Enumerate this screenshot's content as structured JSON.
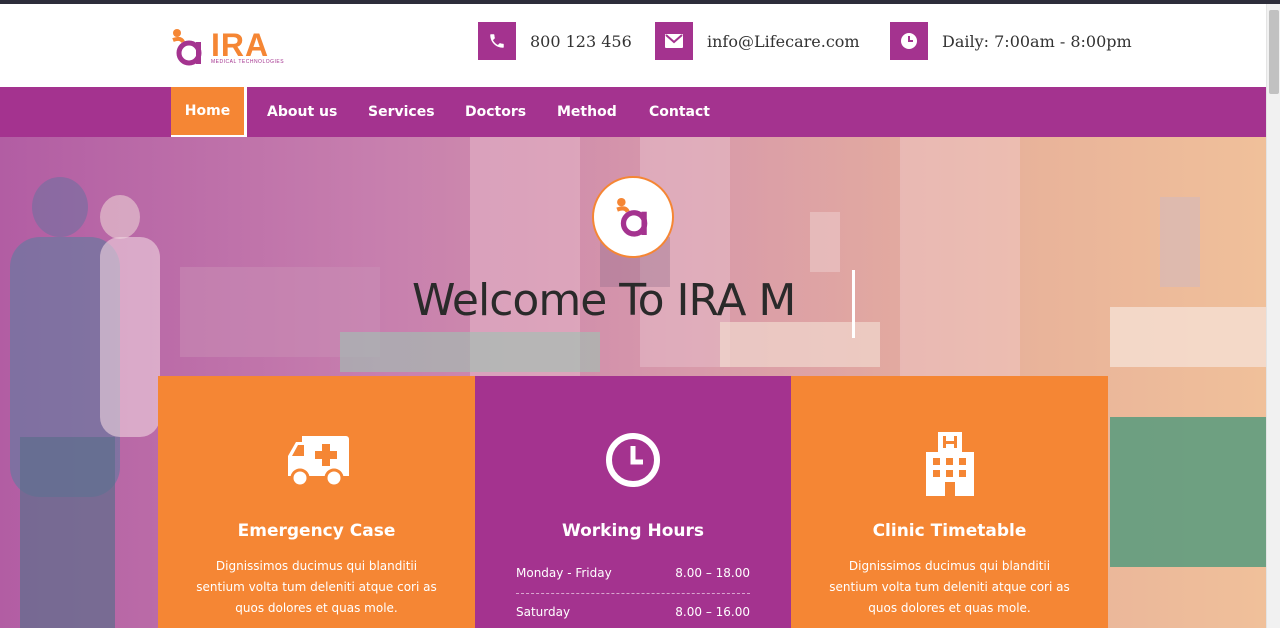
{
  "header": {
    "logo": {
      "word": "IRA",
      "tagline": "MEDICAL TECHNOLOGIES",
      "icon": "ira-logo-mark"
    },
    "contacts": [
      {
        "icon": "phone-icon",
        "text": "800 123 456"
      },
      {
        "icon": "envelope-icon",
        "text": "info@Lifecare.com"
      },
      {
        "icon": "clock-icon",
        "text": "Daily: 7:00am - 8:00pm"
      }
    ]
  },
  "nav": {
    "items": [
      {
        "label": "Home",
        "active": true
      },
      {
        "label": "About us"
      },
      {
        "label": "Services"
      },
      {
        "label": "Doctors"
      },
      {
        "label": "Method"
      },
      {
        "label": "Contact"
      }
    ]
  },
  "hero": {
    "title": "Welcome To IRA M"
  },
  "cards": [
    {
      "icon": "ambulance-icon",
      "title": "Emergency Case",
      "text": "Dignissimos ducimus qui blanditii sentium volta tum deleniti atque cori as quos dolores et quas mole."
    },
    {
      "icon": "clock-icon",
      "title": "Working Hours",
      "hours": [
        {
          "day": "Monday - Friday",
          "time": "8.00 – 18.00"
        },
        {
          "day": "Saturday",
          "time": "8.00 – 16.00"
        }
      ]
    },
    {
      "icon": "hospital-icon",
      "title": "Clinic Timetable",
      "text": "Dignissimos ducimus qui blanditii sentium volta tum deleniti atque cori as quos dolores et quas mole."
    }
  ],
  "colors": {
    "brand_purple": "#a4338f",
    "brand_orange": "#f58634",
    "text_dark": "#333333"
  }
}
